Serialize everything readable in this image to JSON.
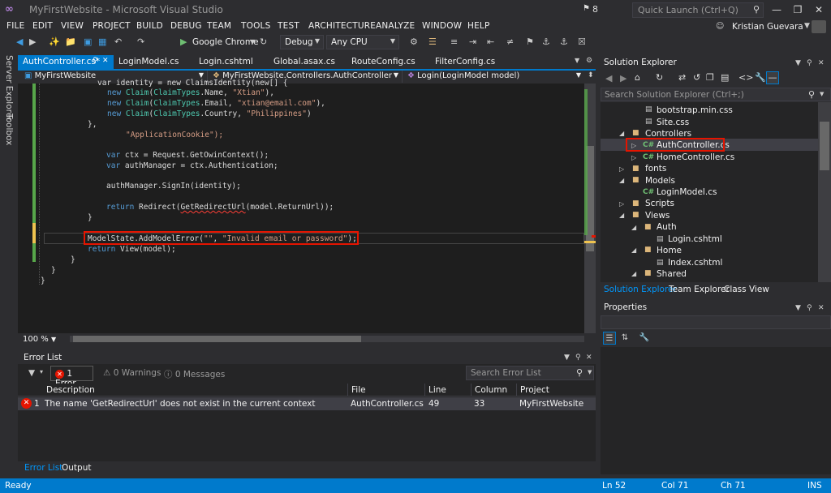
{
  "window": {
    "title": "MyFirstWebsite - Microsoft Visual Studio",
    "flag_count": "8",
    "quick_launch_placeholder": "Quick Launch (Ctrl+Q)"
  },
  "menu": [
    "FILE",
    "EDIT",
    "VIEW",
    "PROJECT",
    "BUILD",
    "DEBUG",
    "TEAM",
    "TOOLS",
    "TEST",
    "ARCHITECTURE",
    "ANALYZE",
    "WINDOW",
    "HELP"
  ],
  "user": {
    "name": "Kristian Guevara"
  },
  "toolbar": {
    "run_label": "Google Chrome",
    "config": "Debug",
    "platform": "Any CPU"
  },
  "left_tabs": [
    "Server Explorer",
    "Toolbox"
  ],
  "doc_tabs": [
    "AuthController.cs*",
    "LoginModel.cs",
    "Login.cshtml",
    "Global.asax.cs",
    "RouteConfig.cs",
    "FilterConfig.cs"
  ],
  "nav": {
    "project": "MyFirstWebsite",
    "class": "MyFirstWebsite.Controllers.AuthController",
    "member": "Login(LoginModel model)"
  },
  "code": {
    "l1": "var identity = new ClaimsIdentity(new[] {",
    "l2_a": "new ",
    "l2_b": "Claim",
    "l2_c": "(",
    "l2_d": "ClaimTypes",
    "l2_e": ".Name, ",
    "l2_f": "\"Xtian\"",
    "l2_g": "),",
    "l3_a": "new ",
    "l3_b": "Claim",
    "l3_c": "(",
    "l3_d": "ClaimTypes",
    "l3_e": ".Email, ",
    "l3_f": "\"xtian@email.com\"",
    "l3_g": "),",
    "l4_a": "new ",
    "l4_b": "Claim",
    "l4_c": "(",
    "l4_d": "ClaimTypes",
    "l4_e": ".Country, ",
    "l4_f": "\"Philippines\"",
    "l4_g": ")",
    "l5": "},",
    "l6": "\"ApplicationCookie\");",
    "l7_a": "var ",
    "l7_b": "ctx = Request.GetOwinContext();",
    "l8_a": "var ",
    "l8_b": "authManager = ctx.Authentication;",
    "l9": "authManager.SignIn(identity);",
    "l10_a": "return ",
    "l10_b": "Redirect(",
    "l10_c": "GetRedirectUrl",
    "l10_d": "(model.ReturnUrl));",
    "l11": "}",
    "l12_a": "ModelState.AddModelError(",
    "l12_b": "\"\"",
    "l12_c": ", ",
    "l12_d": "\"Invalid email or password\"",
    "l12_e": ");",
    "l13_a": "return ",
    "l13_b": "View(model);",
    "l14": "}",
    "l15": "}",
    "l16": "}"
  },
  "zoom": "100 %",
  "error_list": {
    "title": "Error List",
    "errors_btn": "1 Error",
    "warnings_btn": "0 Warnings",
    "messages_btn": "0 Messages",
    "search_placeholder": "Search Error List",
    "columns": [
      "Description",
      "File",
      "Line",
      "Column",
      "Project"
    ],
    "row": {
      "index": "1",
      "description": "The name 'GetRedirectUrl' does not exist in the current context",
      "file": "AuthController.cs",
      "line": "49",
      "column": "33",
      "project": "MyFirstWebsite"
    },
    "tabs": [
      "Error List",
      "Output"
    ]
  },
  "solution_explorer": {
    "title": "Solution Explorer",
    "search_placeholder": "Search Solution Explorer (Ctrl+;)",
    "items": [
      {
        "label": "bootstrap.min.css"
      },
      {
        "label": "Site.css"
      },
      {
        "label": "Controllers"
      },
      {
        "label": "AuthController.cs"
      },
      {
        "label": "HomeController.cs"
      },
      {
        "label": "fonts"
      },
      {
        "label": "Models"
      },
      {
        "label": "LoginModel.cs"
      },
      {
        "label": "Scripts"
      },
      {
        "label": "Views"
      },
      {
        "label": "Auth"
      },
      {
        "label": "Login.cshtml"
      },
      {
        "label": "Home"
      },
      {
        "label": "Index.cshtml"
      },
      {
        "label": "Shared"
      }
    ],
    "tabs": [
      "Solution Explorer",
      "Team Explorer",
      "Class View"
    ]
  },
  "properties": {
    "title": "Properties"
  },
  "status": {
    "ready": "Ready",
    "ln": "Ln 52",
    "col": "Col 71",
    "ch": "Ch 71",
    "mode": "INS"
  },
  "colors": {
    "accent": "#007acc",
    "error": "#e51400",
    "keyword": "#569cd6",
    "type": "#4ec9b0",
    "string": "#d69d85"
  }
}
